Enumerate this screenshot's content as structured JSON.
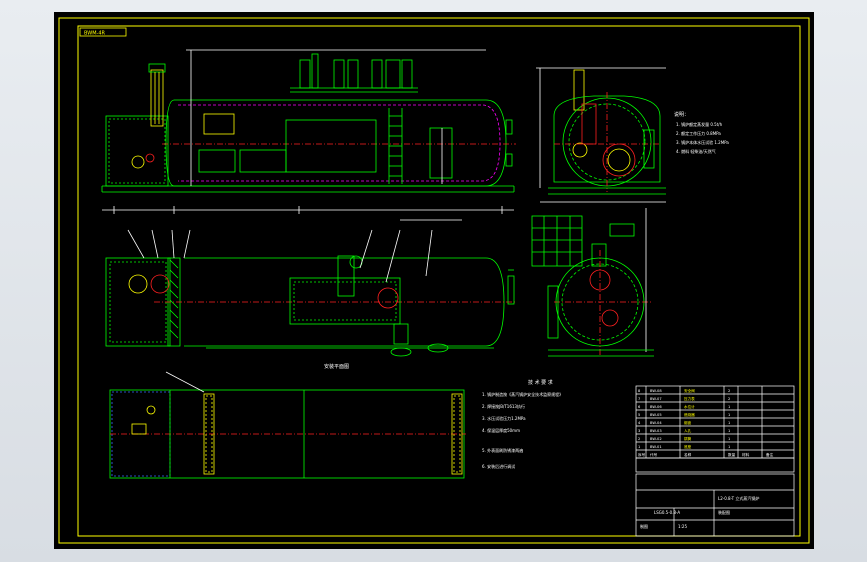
{
  "drawing": {
    "corner_tag": "BWM-4R",
    "plan_title": "安装平面图",
    "notes_title": "说明：",
    "tech_req_title": "技 术 要 求",
    "title_code": "LSG0.5-0.8-A",
    "title_name": "L2-0.8-T  立式蒸汽锅炉",
    "title_sub": "装配图",
    "title_org": "制图",
    "scale": "1:25"
  },
  "notes": [
    "1. 锅炉额定蒸发量 0.5t/h",
    "2. 额定工作压力 0.8MPa",
    "3. 锅炉本体水压试验 1.2MPa",
    "4. 燃料 轻柴油/天然气"
  ],
  "tech_requirements": [
    "1. 锅炉制造按《蒸汽锅炉安全技术监察规程》",
    "2. 焊接按JB/T1613执行",
    "3. 水压试验压力1.2MPa",
    "4. 保温层厚度50mm",
    "5. 外表面刷防锈漆两遍",
    "6. 安装后进行调试"
  ],
  "parts_table": {
    "rows": [
      [
        "8",
        "BW-08",
        "安全阀",
        "2",
        "",
        ""
      ],
      [
        "7",
        "BW-07",
        "压力表",
        "2",
        "",
        ""
      ],
      [
        "6",
        "BW-06",
        "水位计",
        "1",
        "",
        ""
      ],
      [
        "5",
        "BW-05",
        "燃烧器",
        "1",
        "",
        ""
      ],
      [
        "4",
        "BW-04",
        "烟囱",
        "1",
        "",
        ""
      ],
      [
        "3",
        "BW-03",
        "人孔",
        "1",
        "",
        ""
      ],
      [
        "2",
        "BW-02",
        "锅筒",
        "1",
        "",
        ""
      ],
      [
        "1",
        "BW-01",
        "底座",
        "1",
        "",
        ""
      ]
    ],
    "header": [
      "序号",
      "代号",
      "名称",
      "数量",
      "材料",
      "备注"
    ]
  },
  "colors": {
    "line_green": "#00ff00",
    "line_yellow": "#ffff00",
    "line_cyan": "#00ffff",
    "line_red": "#ff2020",
    "line_magenta": "#ff00ff",
    "line_white": "#ffffff",
    "line_blue": "#3a6bff"
  }
}
